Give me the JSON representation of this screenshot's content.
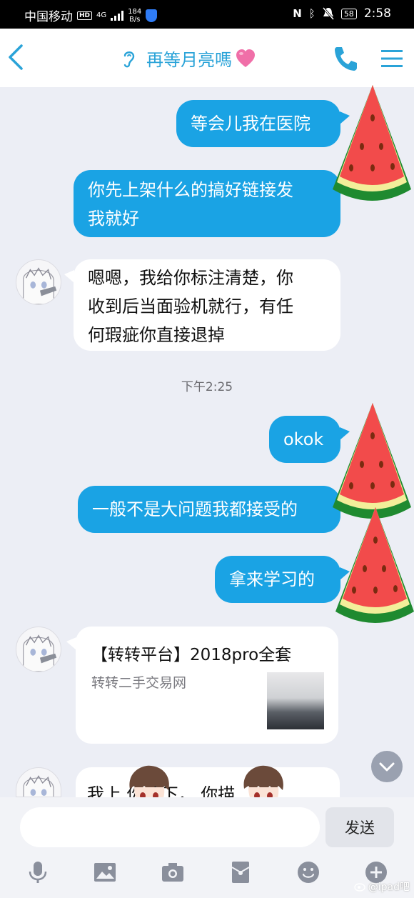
{
  "status_bar": {
    "carrier": "中国移动",
    "hd": "HD",
    "network": "4G",
    "speed_value": "184",
    "speed_unit": "B/s",
    "battery": "58",
    "time": "2:58"
  },
  "header": {
    "title": "再等月亮嗎",
    "title_emoji": "pink-heart",
    "back_icon": "chevron-left-icon",
    "call_icon": "phone-icon",
    "menu_icon": "hamburger-menu-icon"
  },
  "messages": [
    {
      "side": "out",
      "lines": [
        "等会儿我在医院"
      ]
    },
    {
      "side": "out",
      "lines": [
        "你先上架什么的搞好链接发",
        "我就好"
      ]
    },
    {
      "side": "in",
      "lines": [
        "嗯嗯，我给你标注清楚，你",
        "收到后当面验机就行，有任",
        "何瑕疵你直接退掉"
      ]
    },
    {
      "side": "out",
      "lines": [
        "okok"
      ]
    },
    {
      "side": "out",
      "lines": [
        "一般不是大问题我都接受的"
      ]
    },
    {
      "side": "out",
      "lines": [
        "拿来学习的"
      ]
    }
  ],
  "timestamp": "下午2:25",
  "link_card": {
    "title": "【转转平台】2018pro全套",
    "source": "转转二手交易网"
  },
  "partial_message": "我上        你看下，        你描",
  "input": {
    "placeholder": "",
    "send_label": "发送"
  },
  "toolbar": [
    "microphone-icon",
    "image-icon",
    "camera-icon",
    "red-packet-icon",
    "emoji-icon",
    "plus-icon"
  ],
  "watermark": "@ipad吧",
  "colors": {
    "accent": "#1aa3e4",
    "title": "#2aa3d8",
    "background": "#eceef5"
  }
}
